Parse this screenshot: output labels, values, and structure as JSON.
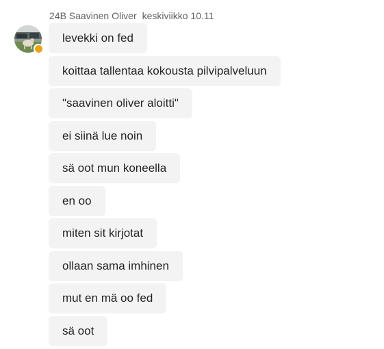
{
  "header": {
    "sender": "24B Saavinen Oliver",
    "timestamp": "keskiviikko 10.11"
  },
  "avatar": {
    "status": "away",
    "status_color": "#e8a317"
  },
  "messages": [
    {
      "text": "levekki on fed"
    },
    {
      "text": "koittaa tallentaa kokousta pilvipalveluun"
    },
    {
      "text": "\"saavinen oliver aloitti\""
    },
    {
      "text": "ei siinä lue noin"
    },
    {
      "text": "sä oot mun koneella"
    },
    {
      "text": "en oo"
    },
    {
      "text": "miten sit kirjotat"
    },
    {
      "text": "ollaan sama imhinen"
    },
    {
      "text": "mut en mä oo fed"
    },
    {
      "text": "sä oot"
    }
  ]
}
